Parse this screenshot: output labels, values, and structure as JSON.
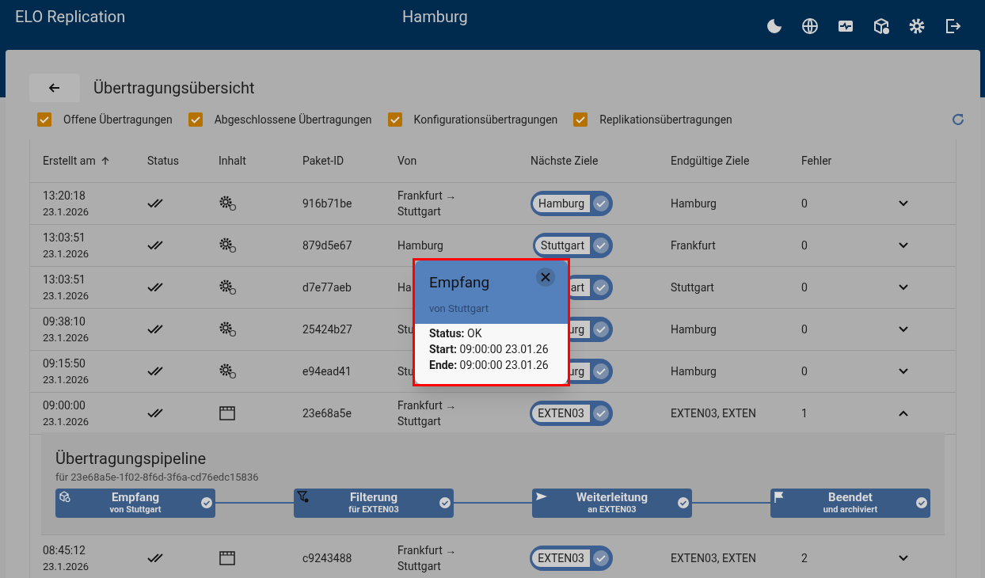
{
  "app_bar": {
    "title": "ELO Replication",
    "location": "Hamburg"
  },
  "page": {
    "title": "Übertragungsübersicht"
  },
  "filters": [
    {
      "label": "Offene Übertragungen",
      "checked": true
    },
    {
      "label": "Abgeschlossene Übertragungen",
      "checked": true
    },
    {
      "label": "Konfigurationsübertragungen",
      "checked": true
    },
    {
      "label": "Replikationsübertragungen",
      "checked": true
    }
  ],
  "table": {
    "columns": [
      "Erstellt am",
      "Status",
      "Inhalt",
      "Paket-ID",
      "Von",
      "Nächste Ziele",
      "Endgültige Ziele",
      "Fehler"
    ],
    "rows": [
      {
        "time": "13:20:18",
        "date": "23.1.2026",
        "kind": "config",
        "id": "916b71be",
        "from": "Frankfurt → Stuttgart",
        "next": "Hamburg",
        "final": "Hamburg",
        "errors": "0",
        "expanded": false
      },
      {
        "time": "13:03:51",
        "date": "23.1.2026",
        "kind": "config",
        "id": "879d5e67",
        "from": "Hamburg",
        "next": "Stuttgart",
        "final": "Frankfurt",
        "errors": "0",
        "expanded": false
      },
      {
        "time": "13:03:51",
        "date": "23.1.2026",
        "kind": "config",
        "id": "d7e77aeb",
        "from": "Ha",
        "next": "art",
        "final": "Stuttgart",
        "errors": "0",
        "expanded": false
      },
      {
        "time": "09:38:10",
        "date": "23.1.2026",
        "kind": "config",
        "id": "25424b27",
        "from": "Stu",
        "next": "urg",
        "final": "Hamburg",
        "errors": "0",
        "expanded": false
      },
      {
        "time": "09:15:50",
        "date": "23.1.2026",
        "kind": "config",
        "id": "e94ead41",
        "from": "Stu",
        "next": "urg",
        "final": "Hamburg",
        "errors": "0",
        "expanded": false
      },
      {
        "time": "09:00:00",
        "date": "23.1.2026",
        "kind": "replication",
        "id": "23e68a5e",
        "from": "Frankfurt → Stuttgart",
        "next": "EXTEN03",
        "final": "EXTEN03, EXTEN",
        "errors": "1",
        "expanded": true
      },
      {
        "time": "08:45:12",
        "date": "23.1.2026",
        "kind": "replication",
        "id": "c9243488",
        "from": "Frankfurt → Stuttgart",
        "next": "EXTEN03",
        "final": "EXTEN03, EXTEN",
        "errors": "2",
        "expanded": false
      }
    ]
  },
  "pipeline": {
    "title": "Übertragungspipeline",
    "subtitle": "für 23e68a5e-1f02-8f6d-3f6a-cd76edc15836",
    "stages": [
      {
        "kind": "receive",
        "title": "Empfang",
        "subtitle": "von Stuttgart"
      },
      {
        "kind": "filter",
        "title": "Filterung",
        "subtitle": "für EXTEN03"
      },
      {
        "kind": "forward",
        "title": "Weiterleitung",
        "subtitle": "an EXTEN03"
      },
      {
        "kind": "finish",
        "title": "Beendet",
        "subtitle": "und archiviert"
      }
    ]
  },
  "popover": {
    "title": "Empfang",
    "subtitle": "von Stuttgart",
    "lines": [
      "**Status:** OK",
      "**Start:** 09:00:00 23.01.26",
      "**Ende:** 09:00:00 23.01.26"
    ]
  }
}
